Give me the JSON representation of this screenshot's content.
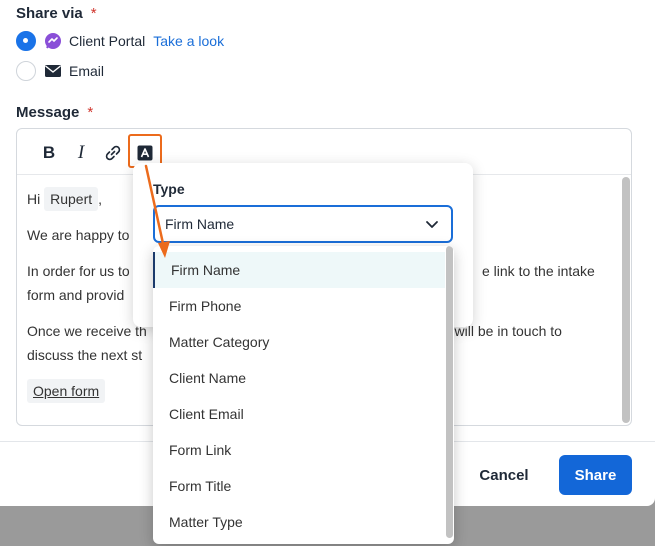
{
  "share_via": {
    "label": "Share via",
    "required_mark": "*",
    "options": [
      {
        "label": "Client Portal",
        "icon": "client-portal-icon",
        "checked": true,
        "link": "Take a look"
      },
      {
        "label": "Email",
        "icon": "envelope-icon",
        "checked": false
      }
    ]
  },
  "message": {
    "label": "Message",
    "required_mark": "*",
    "toolbar": {
      "bold": "B",
      "italic": "I",
      "link_icon": "link-icon",
      "variable_icon": "text-variable-icon"
    },
    "body": {
      "greeting_prefix": "Hi",
      "recipient_chip": "Rupert",
      "greeting_suffix": ",",
      "line1": "We are happy to",
      "line2_start": "In order for us to",
      "line2_end": "e link to the intake",
      "line3": "form and provid",
      "line4_start": "Once we receive th",
      "line4_end": "m will be in touch to",
      "line5": "discuss the next st",
      "form_link": "Open form"
    }
  },
  "variable_popover": {
    "title": "Type",
    "selected": "Firm Name",
    "options": [
      "Firm Name",
      "Firm Phone",
      "Matter Category",
      "Client Name",
      "Client Email",
      "Form Link",
      "Form Title",
      "Matter Type"
    ]
  },
  "footer": {
    "cancel": "Cancel",
    "share": "Share"
  },
  "colors": {
    "accent": "#1367d8",
    "highlight": "#ec6b1c",
    "required": "#d0342c"
  }
}
